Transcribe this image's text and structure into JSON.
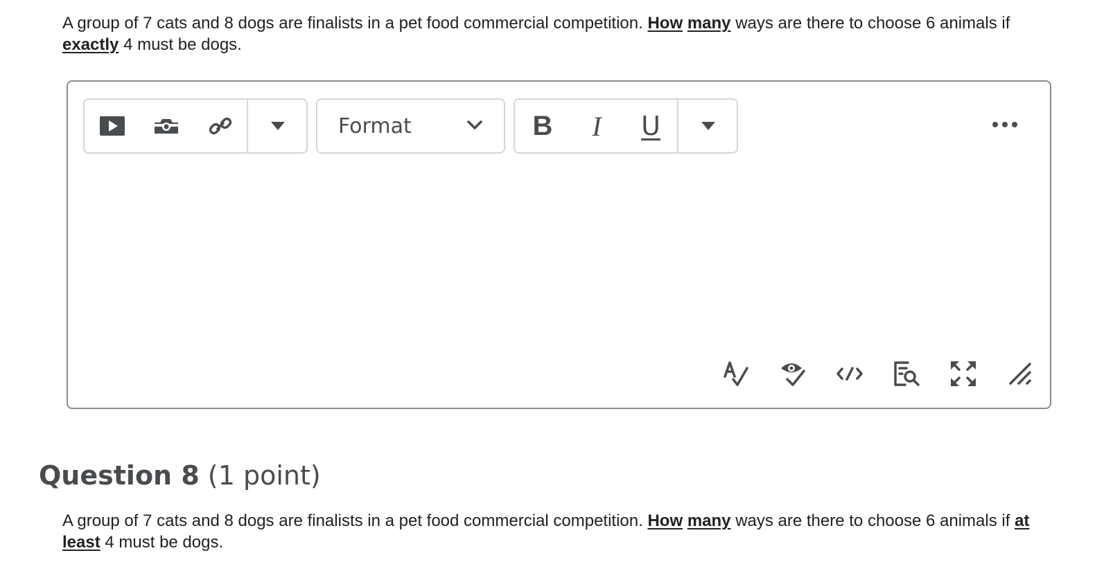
{
  "question7": {
    "text_pre": "A group of 7 cats and 8 dogs are finalists in a pet food commercial competition.",
    "emph1": "How",
    "emph2": "many",
    "text_mid": "ways are there to choose 6 animals if",
    "emph3": "exactly",
    "text_post": "4 must be dogs."
  },
  "editor": {
    "toolbar": {
      "insert_video_icon": "play-video-icon",
      "insert_image_icon": "camera-icon",
      "insert_link_icon": "link-icon",
      "insert_more_icon": "caret-down-icon",
      "format_label": "Format",
      "format_icon": "chevron-down-icon",
      "bold_label": "B",
      "italic_label": "I",
      "underline_label": "U",
      "text_more_icon": "caret-down-icon",
      "more_actions_icon": "ellipsis-icon"
    },
    "bottom_tools": [
      "spellcheck-icon",
      "accessibility-check-icon",
      "source-code-icon",
      "find-replace-icon",
      "fullscreen-icon",
      "resize-handle-icon"
    ],
    "content": ""
  },
  "question8": {
    "title": "Question 8",
    "points": "(1 point)",
    "text_pre": "A group of 7 cats and 8 dogs are finalists in a pet food commercial competition.",
    "emph1": "How",
    "emph2": "many",
    "text_mid": "ways are there to choose 6 animals if",
    "emph3": "at",
    "emph4": "least",
    "text_post": "4 must be dogs."
  },
  "colors": {
    "icon": "#494c4e",
    "border": "#8a8c8f",
    "group_border": "#d4d6d9",
    "text": "#202122"
  }
}
